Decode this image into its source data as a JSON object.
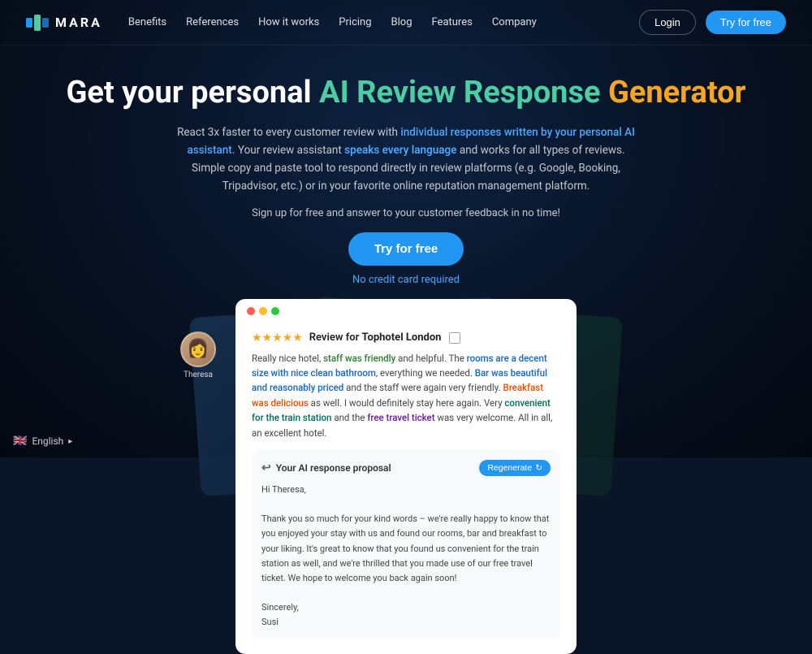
{
  "brand": {
    "logo_letter": "M",
    "name": "MARA"
  },
  "nav": {
    "links": [
      {
        "label": "Benefits",
        "id": "benefits"
      },
      {
        "label": "References",
        "id": "references"
      },
      {
        "label": "How it works",
        "id": "how-it-works"
      },
      {
        "label": "Pricing",
        "id": "pricing"
      },
      {
        "label": "Blog",
        "id": "blog"
      },
      {
        "label": "Features",
        "id": "features"
      },
      {
        "label": "Company",
        "id": "company"
      }
    ],
    "login_label": "Login",
    "try_label": "Try for free"
  },
  "hero": {
    "title_prefix": "Get your personal ",
    "title_ai": "AI Review Response",
    "title_suffix": " ",
    "title_generator": "Generator",
    "desc_plain1": "React 3x faster to every customer review with ",
    "desc_highlight1": "individual responses written by your personal AI assistant.",
    "desc_plain2": " Your review assistant ",
    "desc_highlight2": "speaks every language",
    "desc_plain3": " and works for all types of reviews. Simple copy and paste tool to respond directly in review platforms (e.g. Google, Booking, Tripadvisor, etc.) or in your favorite online reputation management platform.",
    "signup_text": "Sign up for free and answer to your customer feedback in no time!",
    "cta_label": "Try for free",
    "no_cc_label": "No credit card required"
  },
  "card": {
    "review": {
      "stars": "★★★★★",
      "title": "Review for ",
      "hotel": "Tophotel London",
      "text_parts": [
        {
          "text": "Really nice hotel, ",
          "style": "plain"
        },
        {
          "text": "staff was friendly",
          "style": "green"
        },
        {
          "text": " and helpful. The ",
          "style": "plain"
        },
        {
          "text": "rooms are a decent size with nice clean bathroom",
          "style": "blue"
        },
        {
          "text": ", everything we needed. ",
          "style": "plain"
        },
        {
          "text": "Bar was beautiful and reasonably priced",
          "style": "blue"
        },
        {
          "text": " and the staff were again very friendly. ",
          "style": "plain"
        },
        {
          "text": "Breakfast was delicious",
          "style": "amber"
        },
        {
          "text": " as well. I would definitely stay here again. Very ",
          "style": "plain"
        },
        {
          "text": "convenient for the train station",
          "style": "teal"
        },
        {
          "text": " and the ",
          "style": "plain"
        },
        {
          "text": "free travel ticket",
          "style": "purple"
        },
        {
          "text": " was very welcome. All in all, an excellent hotel.",
          "style": "plain"
        }
      ]
    },
    "response": {
      "title": "Your AI response proposal",
      "regenerate_label": "Regenerate",
      "body": "Hi Theresa,\n\nThank you so much for your kind words – we're really happy to know that you enjoyed your stay with us and found our rooms, bar and breakfast to your liking. It's great to know that you found us convenient for the train station as well, and we're thrilled that you made use of our free travel ticket. We hope to welcome you back again soon!\n\nSincerely,\nSusi"
    },
    "reviewer_name": "Theresa"
  },
  "footer": {
    "language": "English"
  }
}
